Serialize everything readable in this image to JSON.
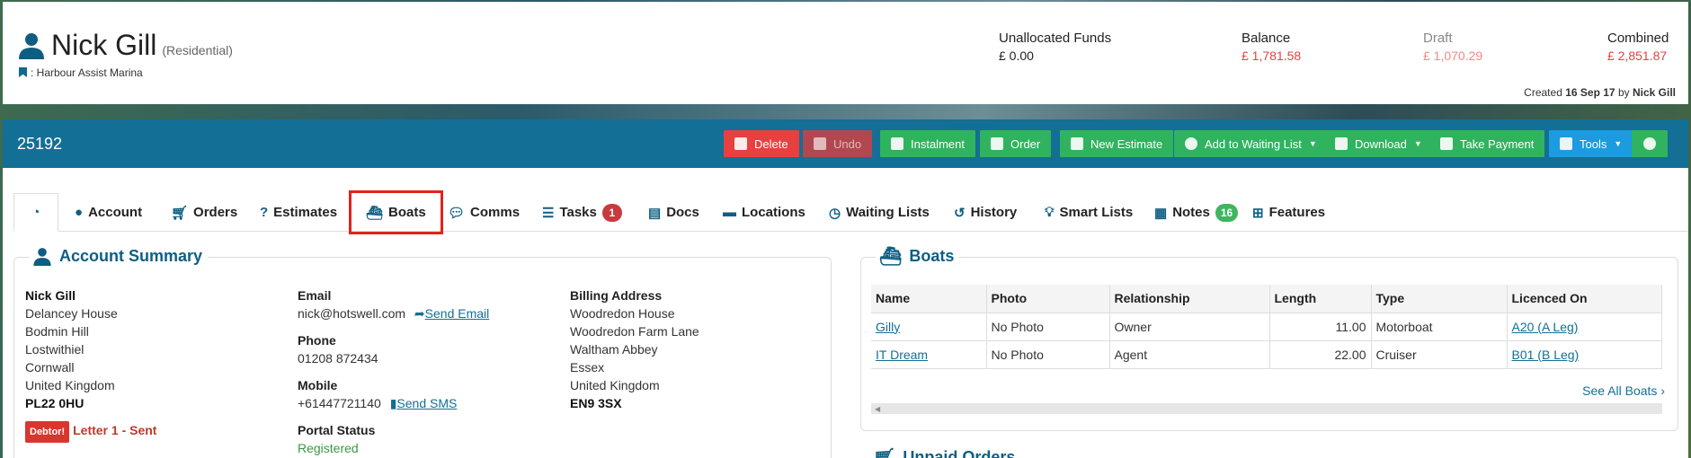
{
  "header": {
    "name": "Nick Gill",
    "customer_type": "(Residential)",
    "marina": ": Harbour Assist Marina",
    "funds": [
      {
        "label": "Unallocated Funds",
        "value": "£ 0.00",
        "color": "#222222"
      },
      {
        "label": "Balance",
        "value": "£ 1,781.58",
        "color": "#e8403f"
      },
      {
        "label": "Draft",
        "value": "£ 1,070.29",
        "color": "#f08a86"
      },
      {
        "label": "Combined",
        "value": "£ 2,851.87",
        "color": "#e8403f"
      }
    ],
    "created_prefix": "Created",
    "created_date": "16 Sep 17",
    "created_by_word": "by",
    "created_by": "Nick Gill"
  },
  "toolbar": {
    "account_number": "25192",
    "buttons": [
      {
        "label": "Delete",
        "icon": "trash-icon"
      },
      {
        "label": "Undo",
        "icon": "undo-icon"
      },
      {
        "label": "Instalment",
        "icon": "refresh-icon"
      },
      {
        "label": "Order",
        "icon": "cart-icon"
      },
      {
        "label": "New Estimate",
        "icon": "question-icon"
      },
      {
        "label": "Add to Waiting List",
        "icon": "clock-icon"
      },
      {
        "label": "Download",
        "icon": "download-icon"
      },
      {
        "label": "Take Payment",
        "icon": "card-icon"
      },
      {
        "label": "Tools",
        "icon": "wand-icon"
      },
      {
        "label": "",
        "icon": "gear-icon"
      }
    ]
  },
  "tabs": [
    {
      "label": "",
      "icon": "dashboard-icon"
    },
    {
      "label": "Account",
      "icon": "user-icon"
    },
    {
      "label": "Orders",
      "icon": "cart-icon"
    },
    {
      "label": "Estimates",
      "icon": "question-icon"
    },
    {
      "label": "Boats",
      "icon": "boat-icon"
    },
    {
      "label": "Comms",
      "icon": "chat-icon"
    },
    {
      "label": "Tasks",
      "icon": "tasks-icon",
      "badge": "1"
    },
    {
      "label": "Docs",
      "icon": "doc-icon"
    },
    {
      "label": "Locations",
      "icon": "bed-icon"
    },
    {
      "label": "Waiting Lists",
      "icon": "clock-icon"
    },
    {
      "label": "History",
      "icon": "history-icon"
    },
    {
      "label": "Smart Lists",
      "icon": "bulb-icon"
    },
    {
      "label": "Notes",
      "icon": "note-icon",
      "badge": "16"
    },
    {
      "label": "Features",
      "icon": "grid-icon"
    }
  ],
  "summary": {
    "title": "Account Summary",
    "address": {
      "name": "Nick Gill",
      "lines": [
        "Delancey House",
        "Bodmin Hill",
        "Lostwithiel",
        "Cornwall",
        "United Kingdom"
      ],
      "postcode": "PL22 0HU"
    },
    "debtor_label": "Debtor!",
    "letter_status": "Letter 1 - Sent",
    "email_label": "Email",
    "email": "nick@hotswell.com",
    "send_email": "Send Email",
    "phone_label": "Phone",
    "phone": "01208 872434",
    "mobile_label": "Mobile",
    "mobile": "+61447721140",
    "send_sms": "Send SMS",
    "portal_label": "Portal Status",
    "portal_value": "Registered",
    "billing_label": "Billing Address",
    "billing_lines": [
      "Woodredon House",
      "Woodredon Farm Lane",
      "Waltham Abbey",
      "Essex",
      "United Kingdom"
    ],
    "billing_postcode": "EN9 3SX"
  },
  "boats": {
    "title": "Boats",
    "columns": [
      "Name",
      "Photo",
      "Relationship",
      "Length",
      "Type",
      "Licenced On"
    ],
    "rows": [
      {
        "name": "Gilly",
        "photo": "No Photo",
        "relationship": "Owner",
        "length": "11.00",
        "type": "Motorboat",
        "licenced_on": "A20 (A Leg)"
      },
      {
        "name": "IT Dream",
        "photo": "No Photo",
        "relationship": "Agent",
        "length": "22.00",
        "type": "Cruiser",
        "licenced_on": "B01 (B Leg)"
      }
    ],
    "see_all": "See All Boats"
  },
  "unpaid_orders": {
    "title": "Unpaid Orders"
  }
}
